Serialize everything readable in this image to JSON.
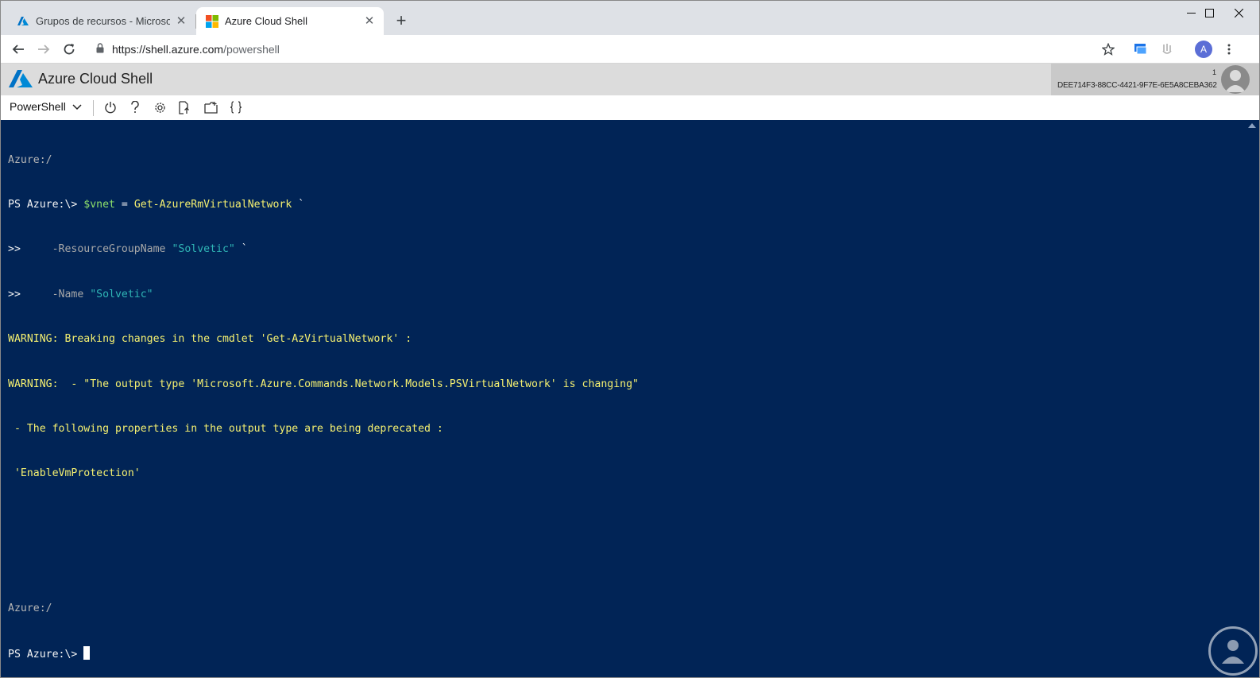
{
  "browser": {
    "tabs": [
      {
        "title": "Grupos de recursos - Microsoft A",
        "close": "✕",
        "active": false
      },
      {
        "title": "Azure Cloud Shell",
        "close": "✕",
        "active": true
      }
    ],
    "new_tab": "+",
    "window_controls": {
      "minimize": "—",
      "maximize": "☐",
      "close": "✕"
    },
    "url_host": "https://shell.azure.com",
    "url_path": "/powershell",
    "profile_initial": "A"
  },
  "header": {
    "title": "Azure Cloud Shell",
    "tenant_count": "1",
    "tenant_id": "DEE714F3-88CC-4421-9F7E-6E5A8CEBA362"
  },
  "shellbar": {
    "shell_type": "PowerShell",
    "icons": [
      "power-icon",
      "help-icon",
      "settings-icon",
      "upload-download-icon",
      "open-editor-icon",
      "braces-icon"
    ]
  },
  "terminal": {
    "line1": "Azure:/",
    "line2_prompt": "PS Azure:\\> ",
    "line2_var": "$vnet",
    "line2_eq": " = ",
    "line2_cmd": "Get-AzureRmVirtualNetwork",
    "line2_tick": " `",
    "line3_prefix": ">>     ",
    "line3_param": "-ResourceGroupName ",
    "line3_value": "\"Solvetic\"",
    "line3_tick": " `",
    "line4_prefix": ">>     ",
    "line4_param": "-Name ",
    "line4_value": "\"Solvetic\"",
    "warn1": "WARNING: Breaking changes in the cmdlet 'Get-AzVirtualNetwork' :",
    "warn2": "WARNING:  - \"The output type 'Microsoft.Azure.Commands.Network.Models.PSVirtualNetwork' is changing\"",
    "warn3": " - The following properties in the output type are being deprecated :",
    "warn4": " 'EnableVmProtection'",
    "line_loc2": "Azure:/",
    "line_prompt2": "PS Azure:\\> "
  }
}
